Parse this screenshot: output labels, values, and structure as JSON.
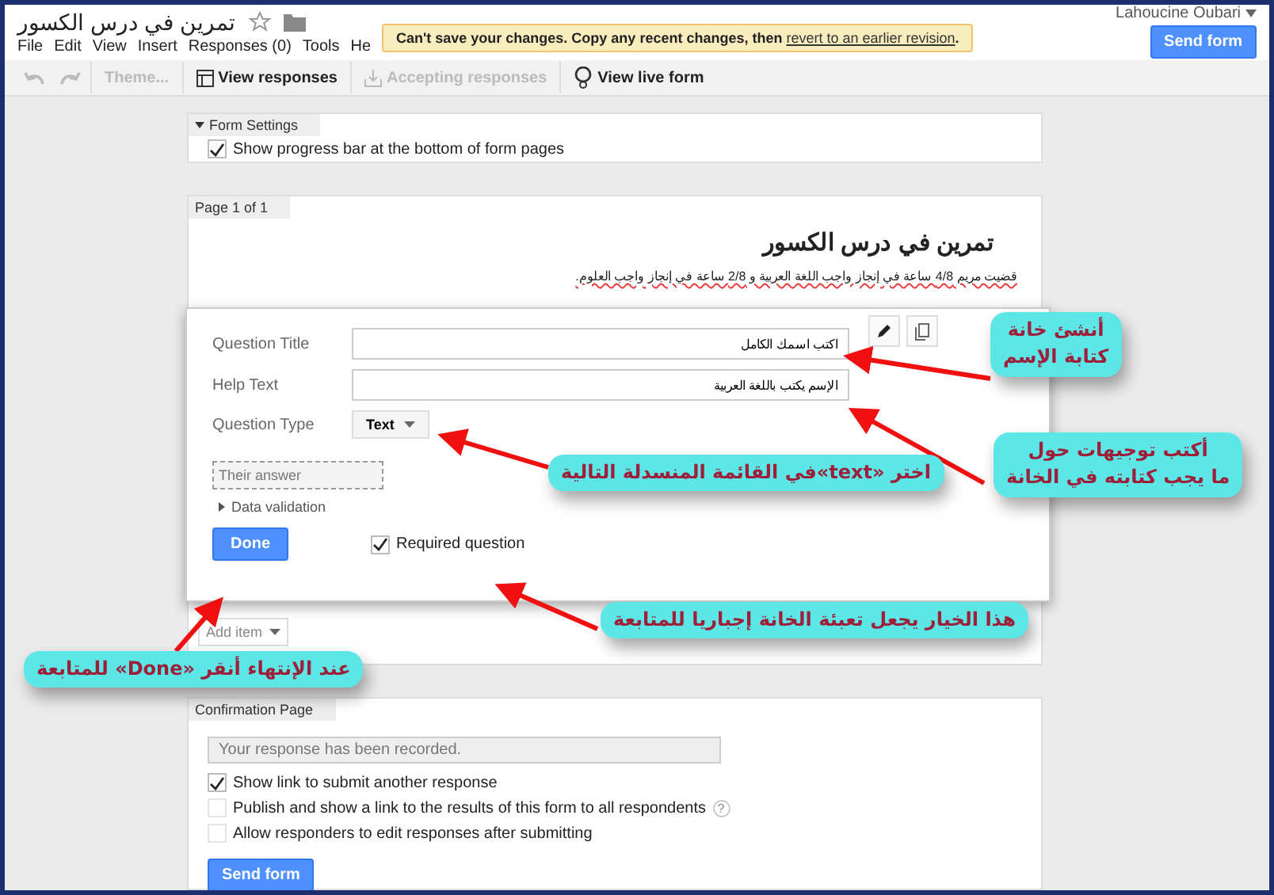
{
  "doc": {
    "title": "تمرين في درس الكسور",
    "account": "Lahoucine Oubari",
    "send_button": "Send form"
  },
  "notice": {
    "text": "Can't save your changes. Copy any recent changes, then",
    "link": "revert to an earlier revision",
    "end": "."
  },
  "menu": [
    "File",
    "Edit",
    "View",
    "Insert",
    "Responses (0)",
    "Tools",
    "He"
  ],
  "toolbar": [
    {
      "label": "Theme...",
      "disabled": true,
      "kind": "plain"
    },
    {
      "label": "View responses",
      "disabled": false,
      "kind": "table"
    },
    {
      "label": "Accepting responses",
      "disabled": true,
      "kind": "inbox"
    },
    {
      "label": "View live form",
      "disabled": false,
      "kind": "live"
    }
  ],
  "form_settings": {
    "header": "Form Settings",
    "options": [
      {
        "label": "Show progress bar at the bottom of form pages",
        "checked": true
      }
    ]
  },
  "page": {
    "header": "Page 1 of 1",
    "title": "تمرين في درس الكسور",
    "description": "قضيت مريم 4/8 ساعة في إنجاز واجب اللغة العربية و 2/8 ساعة في إنجاز واجب العلوم."
  },
  "question_editor": {
    "fields": [
      {
        "label": "Question Title",
        "value": "اكتب اسمك الكامل"
      },
      {
        "label": "Help Text",
        "value": "الإسم يكتب باللغة العربية"
      }
    ],
    "type_label": "Question Type",
    "type_value": "Text",
    "preview": "Their answer",
    "data_validation": "Data validation",
    "done": "Done",
    "required": {
      "label": "Required question",
      "checked": true
    }
  },
  "add_item": "Add item",
  "confirmation": {
    "header": "Confirmation Page",
    "message": "Your response has been recorded.",
    "options": [
      {
        "label": "Show link to submit another response",
        "checked": true,
        "help": false
      },
      {
        "label": "Publish and show a link to the results of this form to all respondents",
        "checked": false,
        "help": true
      },
      {
        "label": "Allow responders to edit responses after submitting",
        "checked": false,
        "help": false
      }
    ],
    "help_mark": "?",
    "send_button": "Send form"
  },
  "annotations": [
    {
      "lines": [
        "أنشئ خانة",
        "كتابة الإسم"
      ]
    },
    {
      "lines": [
        "أكتب توجيهات حول",
        "ما يجب كتابته في الخانة"
      ]
    },
    {
      "lines": [
        "اختر «text»في القائمة المنسدلة التالية"
      ]
    },
    {
      "lines": [
        "هذا الخيار يجعل تعبئة الخانة إجباريا للمتابعة"
      ]
    },
    {
      "lines": [
        "عند الإنتهاء أنقر «Done» للمتابعة"
      ]
    }
  ]
}
